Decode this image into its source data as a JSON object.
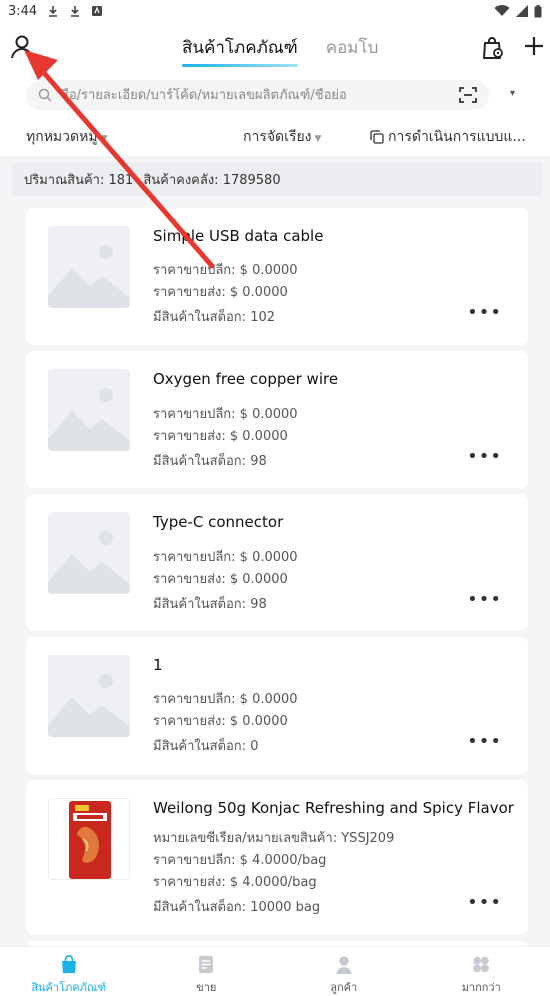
{
  "status_bar": {
    "time": "3:44"
  },
  "header": {
    "tabs": [
      {
        "label": "สินค้าโภคภัณฑ์",
        "active": true
      },
      {
        "label": "คอมโบ",
        "active": false
      }
    ]
  },
  "search": {
    "placeholder": "ชื่อ/รายละเอียด/บาร์โค้ด/หมายเลขผลิตภัณฑ์/ชื่อย่อ",
    "filter_toggle": "▾"
  },
  "filters": {
    "category": "ทุกหมวดหมู่",
    "sort": "การจัดเรียง",
    "batch": "การดำเนินการแบบแ..."
  },
  "summary": {
    "quantity": "ปริมาณสินค้า: 181",
    "stock": "สินค้าคงคลัง: 1789580"
  },
  "products": [
    {
      "name": "Simple USB data cable",
      "retail": "ราคาขายปลีก: $ 0.0000",
      "wholesale": "ราคาขายส่ง: $ 0.0000",
      "stock": "มีสินค้าในสต็อก:  102",
      "more": "•••"
    },
    {
      "name": "Oxygen free copper wire",
      "retail": "ราคาขายปลีก: $ 0.0000",
      "wholesale": "ราคาขายส่ง: $ 0.0000",
      "stock": "มีสินค้าในสต็อก:  98",
      "more": "•••"
    },
    {
      "name": "Type-C connector",
      "retail": "ราคาขายปลีก: $ 0.0000",
      "wholesale": "ราคาขายส่ง: $ 0.0000",
      "stock": "มีสินค้าในสต็อก:  98",
      "more": "•••"
    },
    {
      "name": "1",
      "retail": "ราคาขายปลีก: $ 0.0000",
      "wholesale": "ราคาขายส่ง: $ 0.0000",
      "stock": "มีสินค้าในสต็อก:  0",
      "more": "•••"
    },
    {
      "name": "Weilong 50g Konjac Refreshing and Spicy Flavor",
      "serial": "หมายเลขซีเรียล/หมายเลขสินค้า:  YSSJ209",
      "retail": "ราคาขายปลีก: $ 4.0000/bag",
      "wholesale": "ราคาขายส่ง: $ 4.0000/bag",
      "stock": "มีสินค้าในสต็อก:  10000 bag",
      "more": "•••"
    }
  ],
  "tabbar": [
    {
      "label": "สินค้าโภคภัณฑ์",
      "active": true,
      "icon": "bag-icon"
    },
    {
      "label": "ขาย",
      "active": false,
      "icon": "document-icon"
    },
    {
      "label": "ลูกค้า",
      "active": false,
      "icon": "person-icon"
    },
    {
      "label": "มากกว่า",
      "active": false,
      "icon": "grid-icon"
    }
  ],
  "colors": {
    "accent": "#1ab0e8",
    "annotation": "#e8372f"
  }
}
